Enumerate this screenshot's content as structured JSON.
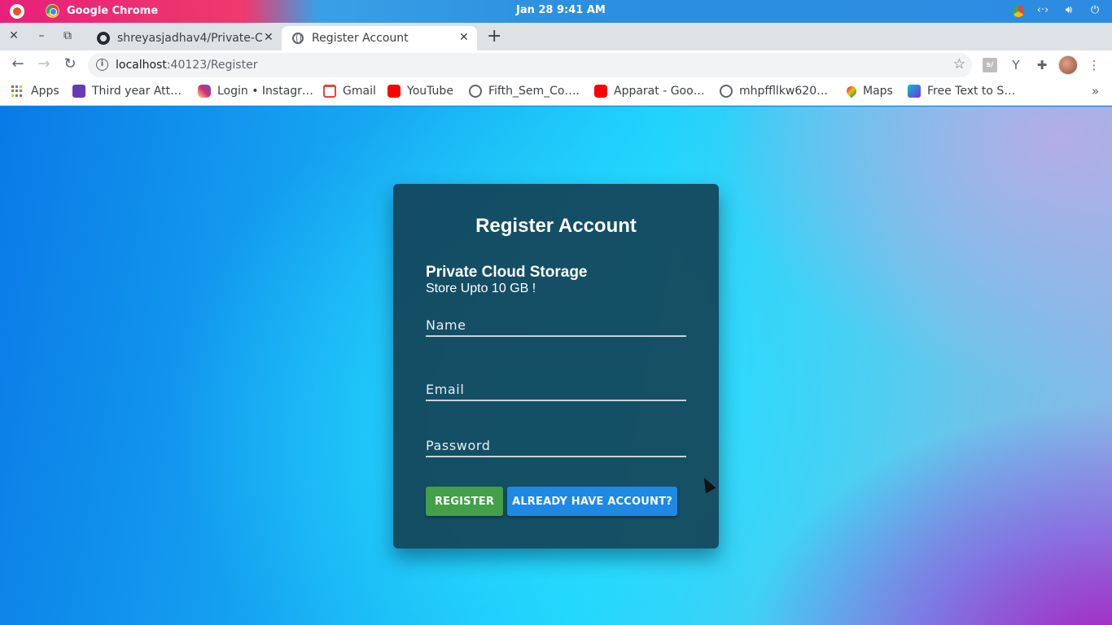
{
  "os": {
    "app_name": "Google Chrome",
    "clock": "Jan 28  9:41 AM"
  },
  "tabs": [
    {
      "title": "shreyasjadhav4/Private-C",
      "icon": "github-icon",
      "active": false
    },
    {
      "title": "Register Account",
      "icon": "globe-icon",
      "active": true
    }
  ],
  "toolbar": {
    "url_host": "localhost",
    "url_rest": ":40123/Register"
  },
  "bookmarks": [
    {
      "label": "Apps",
      "icon": "apps-grid-icon"
    },
    {
      "label": "Third year Att…",
      "icon": "tasks-icon"
    },
    {
      "label": "Login • Instagr…",
      "icon": "instagram-icon"
    },
    {
      "label": "Gmail",
      "icon": "gmail-icon"
    },
    {
      "label": "YouTube",
      "icon": "youtube-icon"
    },
    {
      "label": "Fifth_Sem_Co….",
      "icon": "globe-icon"
    },
    {
      "label": "Apparat - Goo…",
      "icon": "youtube-icon"
    },
    {
      "label": "mhpffllkw620…",
      "icon": "globe-icon"
    },
    {
      "label": "Maps",
      "icon": "maps-icon"
    },
    {
      "label": "Free Text to S…",
      "icon": "text-to-speech-icon"
    }
  ],
  "form": {
    "title": "Register Account",
    "brand": "Private Cloud Storage",
    "tagline": "Store Upto 10 GB !",
    "name_placeholder": "Name",
    "email_placeholder": "Email",
    "password_placeholder": "Password",
    "register_label": "REGISTER",
    "login_label": "ALREADY HAVE ACCOUNT?"
  },
  "colors": {
    "register_button": "#43a047",
    "login_button": "#1e88e5",
    "card": "#123c50"
  }
}
